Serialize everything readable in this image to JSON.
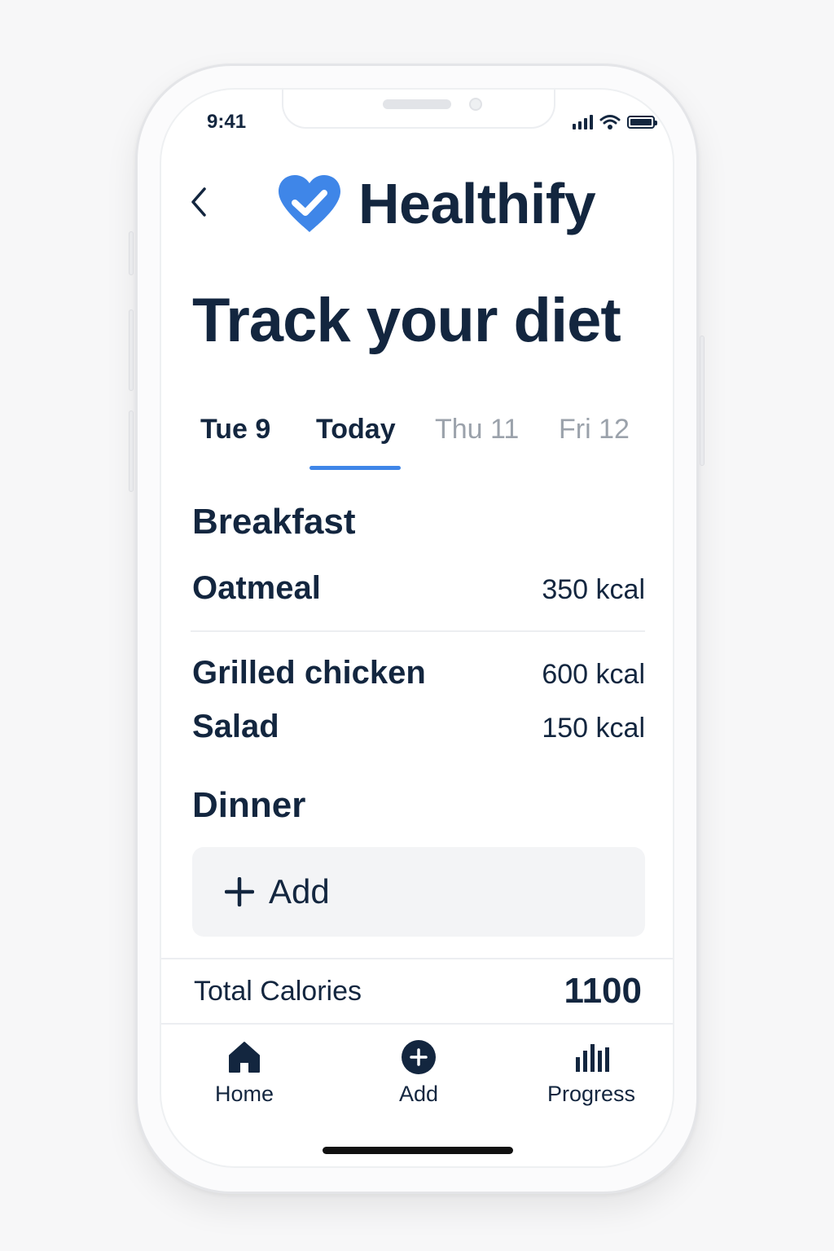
{
  "status_bar": {
    "time": "9:41"
  },
  "header": {
    "back_icon": "chevron-left-icon",
    "logo_icon": "heart-check-icon",
    "app_name": "Healthify"
  },
  "page_title": "Track your diet",
  "day_tabs": [
    {
      "label": "Tue 9",
      "state": "past"
    },
    {
      "label": "Today",
      "state": "active"
    },
    {
      "label": "Thu 11",
      "state": "future"
    },
    {
      "label": "Fri 12",
      "state": "future"
    }
  ],
  "meals": {
    "breakfast": {
      "title": "Breakfast",
      "items": [
        {
          "name": "Oatmeal",
          "kcal": "350 kcal"
        }
      ]
    },
    "lunch": {
      "items": [
        {
          "name": "Grilled chicken",
          "kcal": "600 kcal"
        },
        {
          "name": "Salad",
          "kcal": "150 kcal"
        }
      ]
    },
    "dinner": {
      "title": "Dinner",
      "add_label": "Add"
    }
  },
  "total": {
    "label": "Total Calories",
    "value": "1100"
  },
  "bottom_nav": [
    {
      "label": "Home",
      "icon": "home-icon"
    },
    {
      "label": "Add",
      "icon": "plus-circle-icon"
    },
    {
      "label": "Progress",
      "icon": "bar-chart-icon"
    }
  ],
  "colors": {
    "accent": "#3f86e8",
    "text": "#13263f",
    "muted": "#9ba2ab",
    "add_bg": "#f3f4f6"
  }
}
